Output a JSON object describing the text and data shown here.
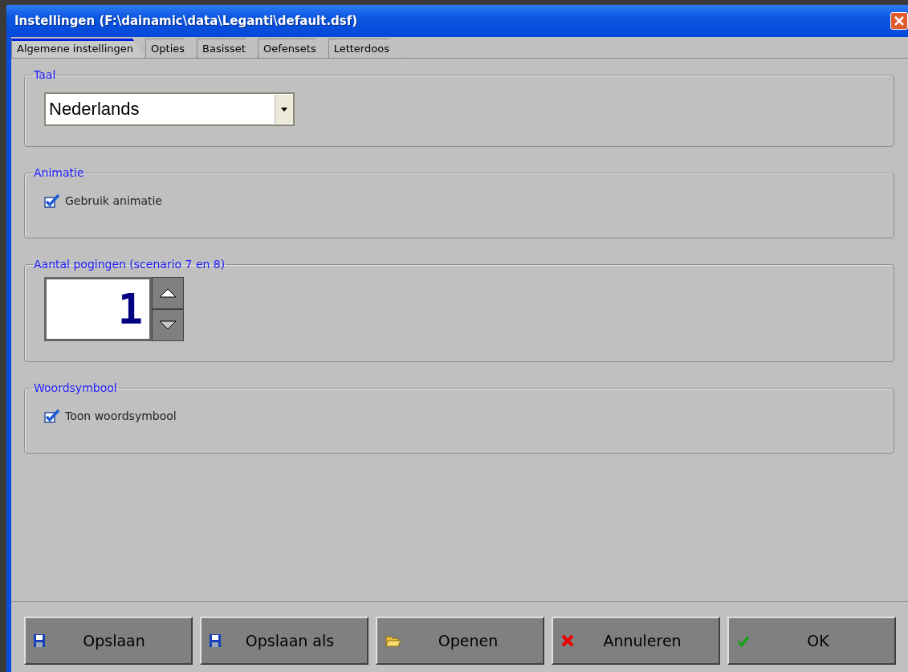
{
  "window": {
    "title": "Instellingen (F:\\dainamic\\data\\Leganti\\default.dsf)"
  },
  "tabs": [
    {
      "label": "Algemene instellingen",
      "selected": true
    },
    {
      "label": "Opties",
      "selected": false
    },
    {
      "label": "Basisset",
      "selected": false
    },
    {
      "label": "Oefensets",
      "selected": false
    },
    {
      "label": "Letterdoos",
      "selected": false
    }
  ],
  "groups": [
    {
      "title": "Taal",
      "kind": "dropdown",
      "value": "Nederlands"
    },
    {
      "title": "Animatie",
      "kind": "checkbox",
      "label": "Gebruik animatie",
      "checked": true
    },
    {
      "title": "Aantal pogingen (scenario 7 en 8)",
      "kind": "spinner",
      "value": "1"
    },
    {
      "title": "Woordsymbool",
      "kind": "checkbox",
      "label": "Toon woordsymbool",
      "checked": true
    }
  ],
  "buttons": [
    {
      "label": "Opslaan",
      "kind": "save"
    },
    {
      "label": "Opslaan als",
      "kind": "save"
    },
    {
      "label": "Openen",
      "kind": "open"
    },
    {
      "label": "Annuleren",
      "kind": "cancel"
    },
    {
      "label": "OK",
      "kind": "ok"
    }
  ]
}
